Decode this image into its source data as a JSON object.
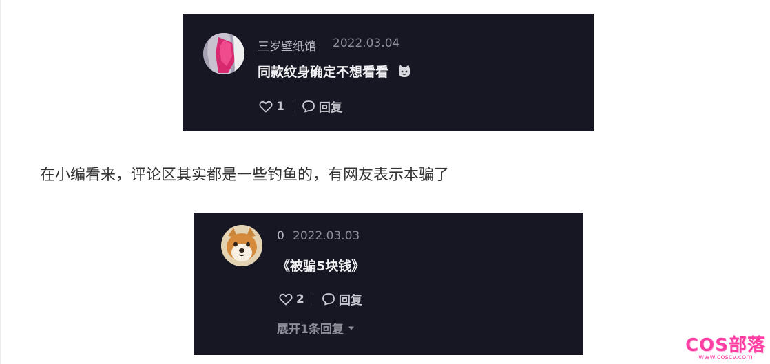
{
  "comments": [
    {
      "username": "三岁壁纸馆",
      "date": "2022.03.04",
      "text": "同款纹身确定不想看看",
      "emoji_icon": "cat-emoji-icon",
      "likes": "1",
      "reply_label": "回复"
    },
    {
      "username": "0",
      "date": "2022.03.03",
      "text": "《被骗5块钱》",
      "likes": "2",
      "reply_label": "回复",
      "expand_label": "展开1条回复"
    }
  ],
  "article": {
    "paragraph": "在小编看来，评论区其实都是一些钓鱼的，有网友表示本骗了"
  },
  "watermark": {
    "logo": "COS部落",
    "url": "www.coscv.com"
  },
  "colors": {
    "card_bg": "#161722",
    "watermark": "#ff3fa4",
    "avatar1_accent": "#d8296f"
  }
}
